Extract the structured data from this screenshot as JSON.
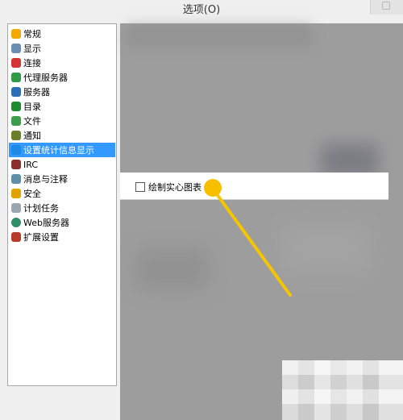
{
  "window": {
    "title": "选项(O)"
  },
  "sidebar": {
    "items": [
      {
        "label": "常规",
        "icon": "settings-icon",
        "color": "#f2a900"
      },
      {
        "label": "显示",
        "icon": "display-icon",
        "color": "#6b8fb3"
      },
      {
        "label": "连接",
        "icon": "connection-icon",
        "color": "#d33434"
      },
      {
        "label": "代理服务器",
        "icon": "proxy-icon",
        "color": "#2e9c47"
      },
      {
        "label": "服务器",
        "icon": "server-icon",
        "color": "#2c6fb7"
      },
      {
        "label": "目录",
        "icon": "folder-icon",
        "color": "#1f8a2f"
      },
      {
        "label": "文件",
        "icon": "file-icon",
        "color": "#3c9d4c"
      },
      {
        "label": "通知",
        "icon": "notification-icon",
        "color": "#6b7f2a"
      },
      {
        "label": "设置统计信息显示",
        "icon": "stats-icon",
        "color": "#1e88e5"
      },
      {
        "label": "IRC",
        "icon": "irc-icon",
        "color": "#8b2e2e"
      },
      {
        "label": "消息与注释",
        "icon": "message-icon",
        "color": "#5f8fa8"
      },
      {
        "label": "安全",
        "icon": "lock-icon",
        "color": "#e1a300"
      },
      {
        "label": "计划任务",
        "icon": "calendar-icon",
        "color": "#9aa7b2"
      },
      {
        "label": "Web服务器",
        "icon": "web-icon",
        "color": "#2f8f6a"
      },
      {
        "label": "扩展设置",
        "icon": "extension-icon",
        "color": "#b73c2b"
      }
    ],
    "selected_index": 8
  },
  "options": {
    "draw_solid_chart": {
      "label": "绘制实心图表",
      "checked": false
    }
  },
  "annotation": {
    "color": "#f7c000"
  }
}
